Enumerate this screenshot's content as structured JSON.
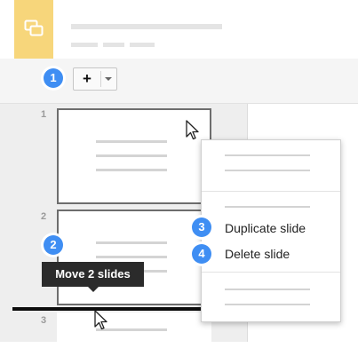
{
  "toolbar": {
    "new_slide_label": "+",
    "new_slide_menu_caret": "caret-down"
  },
  "filmstrip": {
    "slide_numbers": [
      "1",
      "2",
      "3"
    ]
  },
  "tooltip": {
    "text": "Move 2 slides"
  },
  "context_menu": {
    "duplicate_label": "Duplicate slide",
    "delete_label": "Delete slide"
  },
  "callouts": [
    "1",
    "2",
    "3",
    "4"
  ],
  "colors": {
    "logo_background": "#f7d67b",
    "callout_badge": "#3f8ef3",
    "tooltip_background": "#2b2b2b",
    "drop_indicator": "#0d0d0d"
  }
}
